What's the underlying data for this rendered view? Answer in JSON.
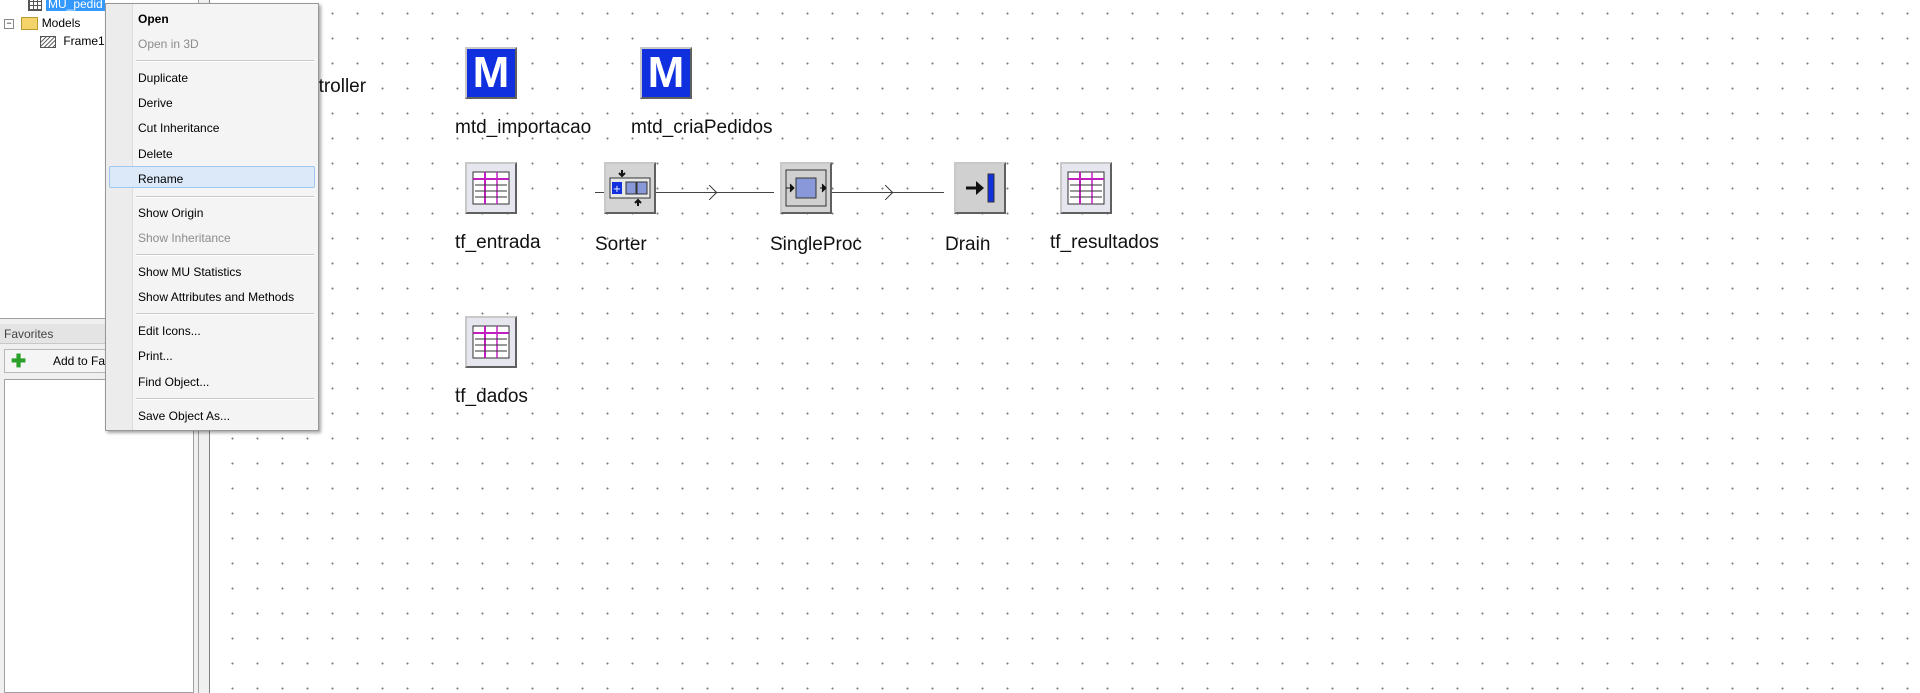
{
  "tree": {
    "selected_item": "MU_pedid",
    "models_folder": "Models",
    "frame_item": "Frame1"
  },
  "favorites": {
    "header": "Favorites",
    "add_button": "Add to Fav"
  },
  "canvas": {
    "partial_label": "ntroller",
    "objects": {
      "mtd_importacao": "mtd_importacao",
      "mtd_criaPedidos": "mtd_criaPedidos",
      "tf_entrada": "tf_entrada",
      "sorter": "Sorter",
      "singleproc": "SingleProc",
      "drain": "Drain",
      "tf_resultados": "tf_resultados",
      "tf_dados": "tf_dados"
    }
  },
  "context_menu": {
    "open": "Open",
    "open_3d": "Open in 3D",
    "duplicate": "Duplicate",
    "derive": "Derive",
    "cut_inheritance": "Cut Inheritance",
    "delete": "Delete",
    "rename": "Rename",
    "show_origin": "Show Origin",
    "show_inheritance": "Show Inheritance",
    "show_mu_statistics": "Show MU Statistics",
    "show_attributes": "Show Attributes and Methods",
    "edit_icons": "Edit Icons...",
    "print": "Print...",
    "find_object": "Find Object...",
    "save_object_as": "Save Object As..."
  },
  "colors": {
    "selection": "#3399ff",
    "method_icon": "#1030e0",
    "menu_highlight": "#dbe9f9"
  }
}
